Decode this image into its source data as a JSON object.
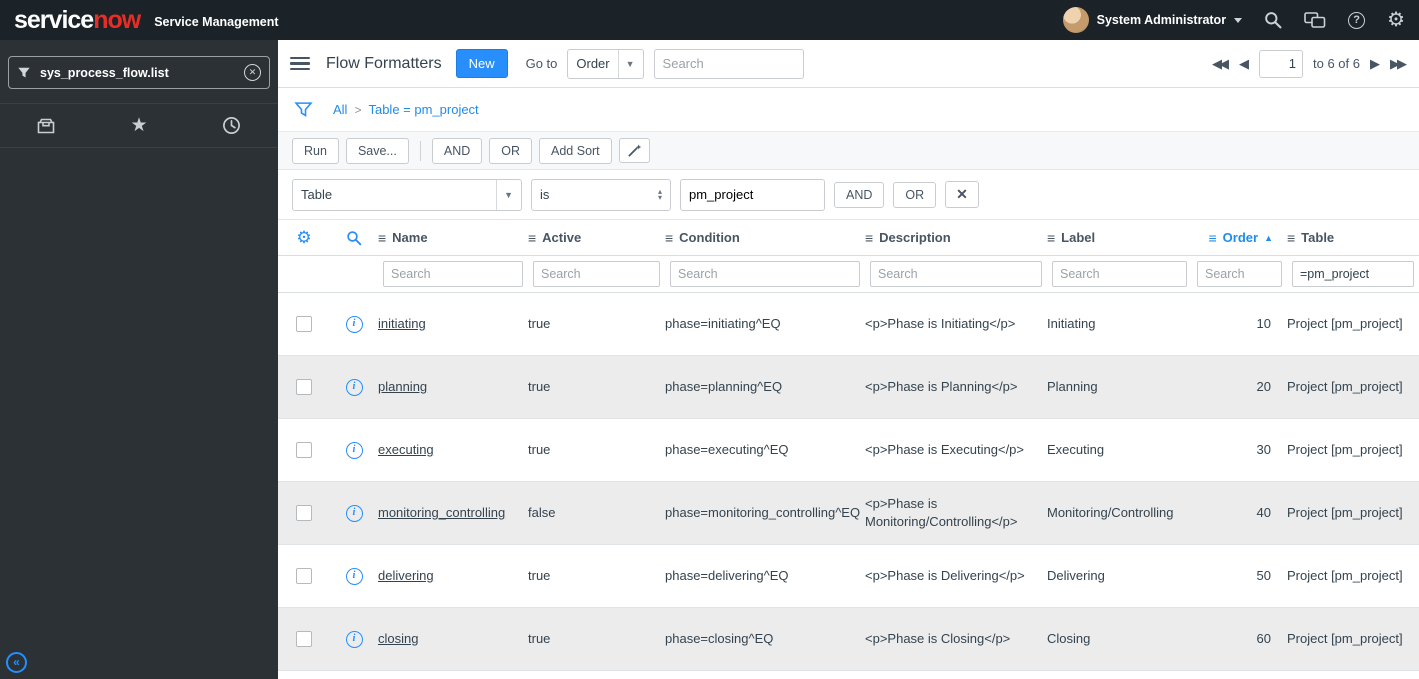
{
  "header": {
    "logo": {
      "service": "service",
      "now": "now"
    },
    "product_label": "Service Management",
    "user_name": "System Administrator"
  },
  "nav_sidebar": {
    "filter_value": "sys_process_flow.list"
  },
  "list_toolbar": {
    "title": "Flow Formatters",
    "new_button_label": "New",
    "goto_label": "Go to",
    "goto_selected": "Order",
    "search_placeholder": "Search",
    "page_value": "1",
    "page_range": "to 6 of 6"
  },
  "breadcrumb": {
    "all_label": "All",
    "separator": ">",
    "filter_label": "Table = pm_project"
  },
  "filter_bar": {
    "run_label": "Run",
    "save_label": "Save...",
    "and_label": "AND",
    "or_label": "OR",
    "add_sort_label": "Add Sort"
  },
  "condition_builder": {
    "field_selected": "Table",
    "operator_selected": "is",
    "value": "pm_project",
    "and_label": "AND",
    "or_label": "OR",
    "delete_label": "✕"
  },
  "table": {
    "columns": [
      {
        "label": "Name"
      },
      {
        "label": "Active"
      },
      {
        "label": "Condition"
      },
      {
        "label": "Description"
      },
      {
        "label": "Label"
      },
      {
        "label": "Order",
        "sorted": "asc"
      },
      {
        "label": "Table"
      }
    ],
    "search_placeholder": "Search",
    "table_column_search_value": "=pm_project",
    "rows": [
      {
        "name": "initiating",
        "active": "true",
        "condition": "phase=initiating^EQ",
        "description": "<p>Phase is Initiating</p>",
        "label": "Initiating",
        "order": "10",
        "table": "Project [pm_project]"
      },
      {
        "name": "planning",
        "active": "true",
        "condition": "phase=planning^EQ",
        "description": "<p>Phase is Planning</p>",
        "label": "Planning",
        "order": "20",
        "table": "Project [pm_project]"
      },
      {
        "name": "executing",
        "active": "true",
        "condition": "phase=executing^EQ",
        "description": "<p>Phase is Executing</p>",
        "label": "Executing",
        "order": "30",
        "table": "Project [pm_project]"
      },
      {
        "name": "monitoring_controlling",
        "active": "false",
        "condition": "phase=monitoring_controlling^EQ",
        "description": "<p>Phase is Monitoring/Controlling</p>",
        "label": "Monitoring/Controlling",
        "order": "40",
        "table": "Project [pm_project]"
      },
      {
        "name": "delivering",
        "active": "true",
        "condition": "phase=delivering^EQ",
        "description": "<p>Phase is Delivering</p>",
        "label": "Delivering",
        "order": "50",
        "table": "Project [pm_project]"
      },
      {
        "name": "closing",
        "active": "true",
        "condition": "phase=closing^EQ",
        "description": "<p>Phase is Closing</p>",
        "label": "Closing",
        "order": "60",
        "table": "Project [pm_project]"
      }
    ]
  },
  "colors": {
    "accent_blue": "#278efc",
    "link_blue": "#1f8ceb",
    "logo_red": "#e62e26",
    "header_bg": "#1b2228",
    "sidebar_bg": "#2b3135"
  }
}
